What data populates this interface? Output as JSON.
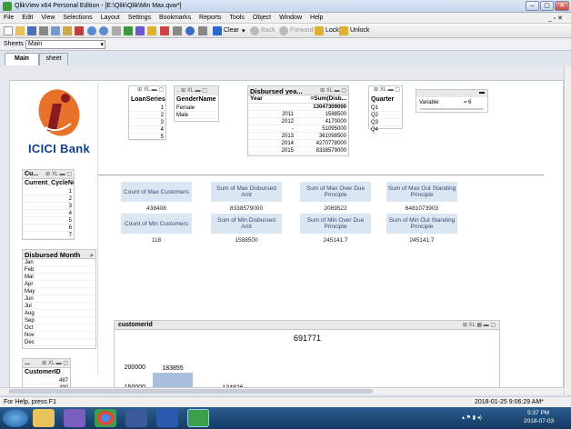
{
  "window": {
    "title": "QlikView x64 Personal Edition - [E:\\Qlik\\Qlik\\Min Max.qvw*]"
  },
  "menu": [
    "File",
    "Edit",
    "View",
    "Selections",
    "Layout",
    "Settings",
    "Bookmarks",
    "Reports",
    "Tools",
    "Object",
    "Window",
    "Help"
  ],
  "toolbar": {
    "clear": "Clear",
    "back": "Back",
    "forward": "Forward",
    "lock": "Lock",
    "unlock": "Unlock"
  },
  "sheets": {
    "label": "Sheets",
    "value": "Main"
  },
  "tabs": [
    "Main",
    "sheet"
  ],
  "logo": {
    "text": "ICICI Bank"
  },
  "loanseries": {
    "header": "LoanSeries",
    "values": [
      "1",
      "2",
      "3",
      "4",
      "5"
    ]
  },
  "gender": {
    "header": "GenderName",
    "values": [
      "Female",
      "Male"
    ]
  },
  "disbursed_year": {
    "title": "Disbursed yea...",
    "col1": "Year",
    "col2": "=Sum(Disb...",
    "total": "13047309000",
    "rows": [
      [
        "2011",
        "1588500"
      ],
      [
        "2012",
        "4170000"
      ],
      [
        "-",
        "51095000"
      ],
      [
        "2013",
        "361098500"
      ],
      [
        "2014",
        "4270778000"
      ],
      [
        "2015",
        "8338579000"
      ]
    ]
  },
  "quarter": {
    "header": "Quarter",
    "values": [
      "Q1",
      "Q2",
      "Q3",
      "Q4"
    ]
  },
  "variable": {
    "label": "Variable",
    "value": "= 6"
  },
  "cycle": {
    "title": "Cu...",
    "header": "Current_CycleNo",
    "values": [
      "1",
      "2",
      "3",
      "4",
      "5",
      "6",
      "7"
    ]
  },
  "month": {
    "header": "Disbursed Month",
    "values": [
      "Jan",
      "Feb",
      "Mar",
      "Apr",
      "May",
      "Jun",
      "Jul",
      "Aug",
      "Sep",
      "Oct",
      "Nov",
      "Dec"
    ]
  },
  "customerid_lb": {
    "title": "...",
    "header": "CustomerID",
    "values": [
      "487",
      "490"
    ]
  },
  "kpis": [
    {
      "label": "Count of Max Customers",
      "value": "438408"
    },
    {
      "label": "Sum of Max Disbursed Amt",
      "value": "8338579000"
    },
    {
      "label": "Sum of Max Over Due Principle",
      "value": "2069522"
    },
    {
      "label": "Sum of Max Out Standing Principle",
      "value": "6481073903"
    },
    {
      "label": "Count of Min Customers",
      "value": "118"
    },
    {
      "label": "Sum of Min Disbursed Amt",
      "value": "1588500"
    },
    {
      "label": "Sum of Min Over Due Principle",
      "value": "245141.7"
    },
    {
      "label": "Sum of Min Out Standing Principle",
      "value": "245141.7"
    }
  ],
  "customer_chart": {
    "title": "customerid",
    "top_label": "691771",
    "ticks": [
      "200000",
      "150000"
    ],
    "bars": [
      {
        "label": "183855",
        "value": 183855
      },
      {
        "label": "134826",
        "value": 134826
      }
    ]
  },
  "status": {
    "help": "For Help, press F1",
    "datetime": "2018-01-25 9:06:29 AM*"
  },
  "taskbar": {
    "time": "5:37 PM",
    "date": "2018-07-03"
  },
  "colors": {
    "accent": "#a7bfdc",
    "kpi_bg": "#dbe6f3",
    "logo_orange": "#e8722a",
    "logo_maroon": "#8a1c1f",
    "logo_text": "#0e3f87"
  }
}
